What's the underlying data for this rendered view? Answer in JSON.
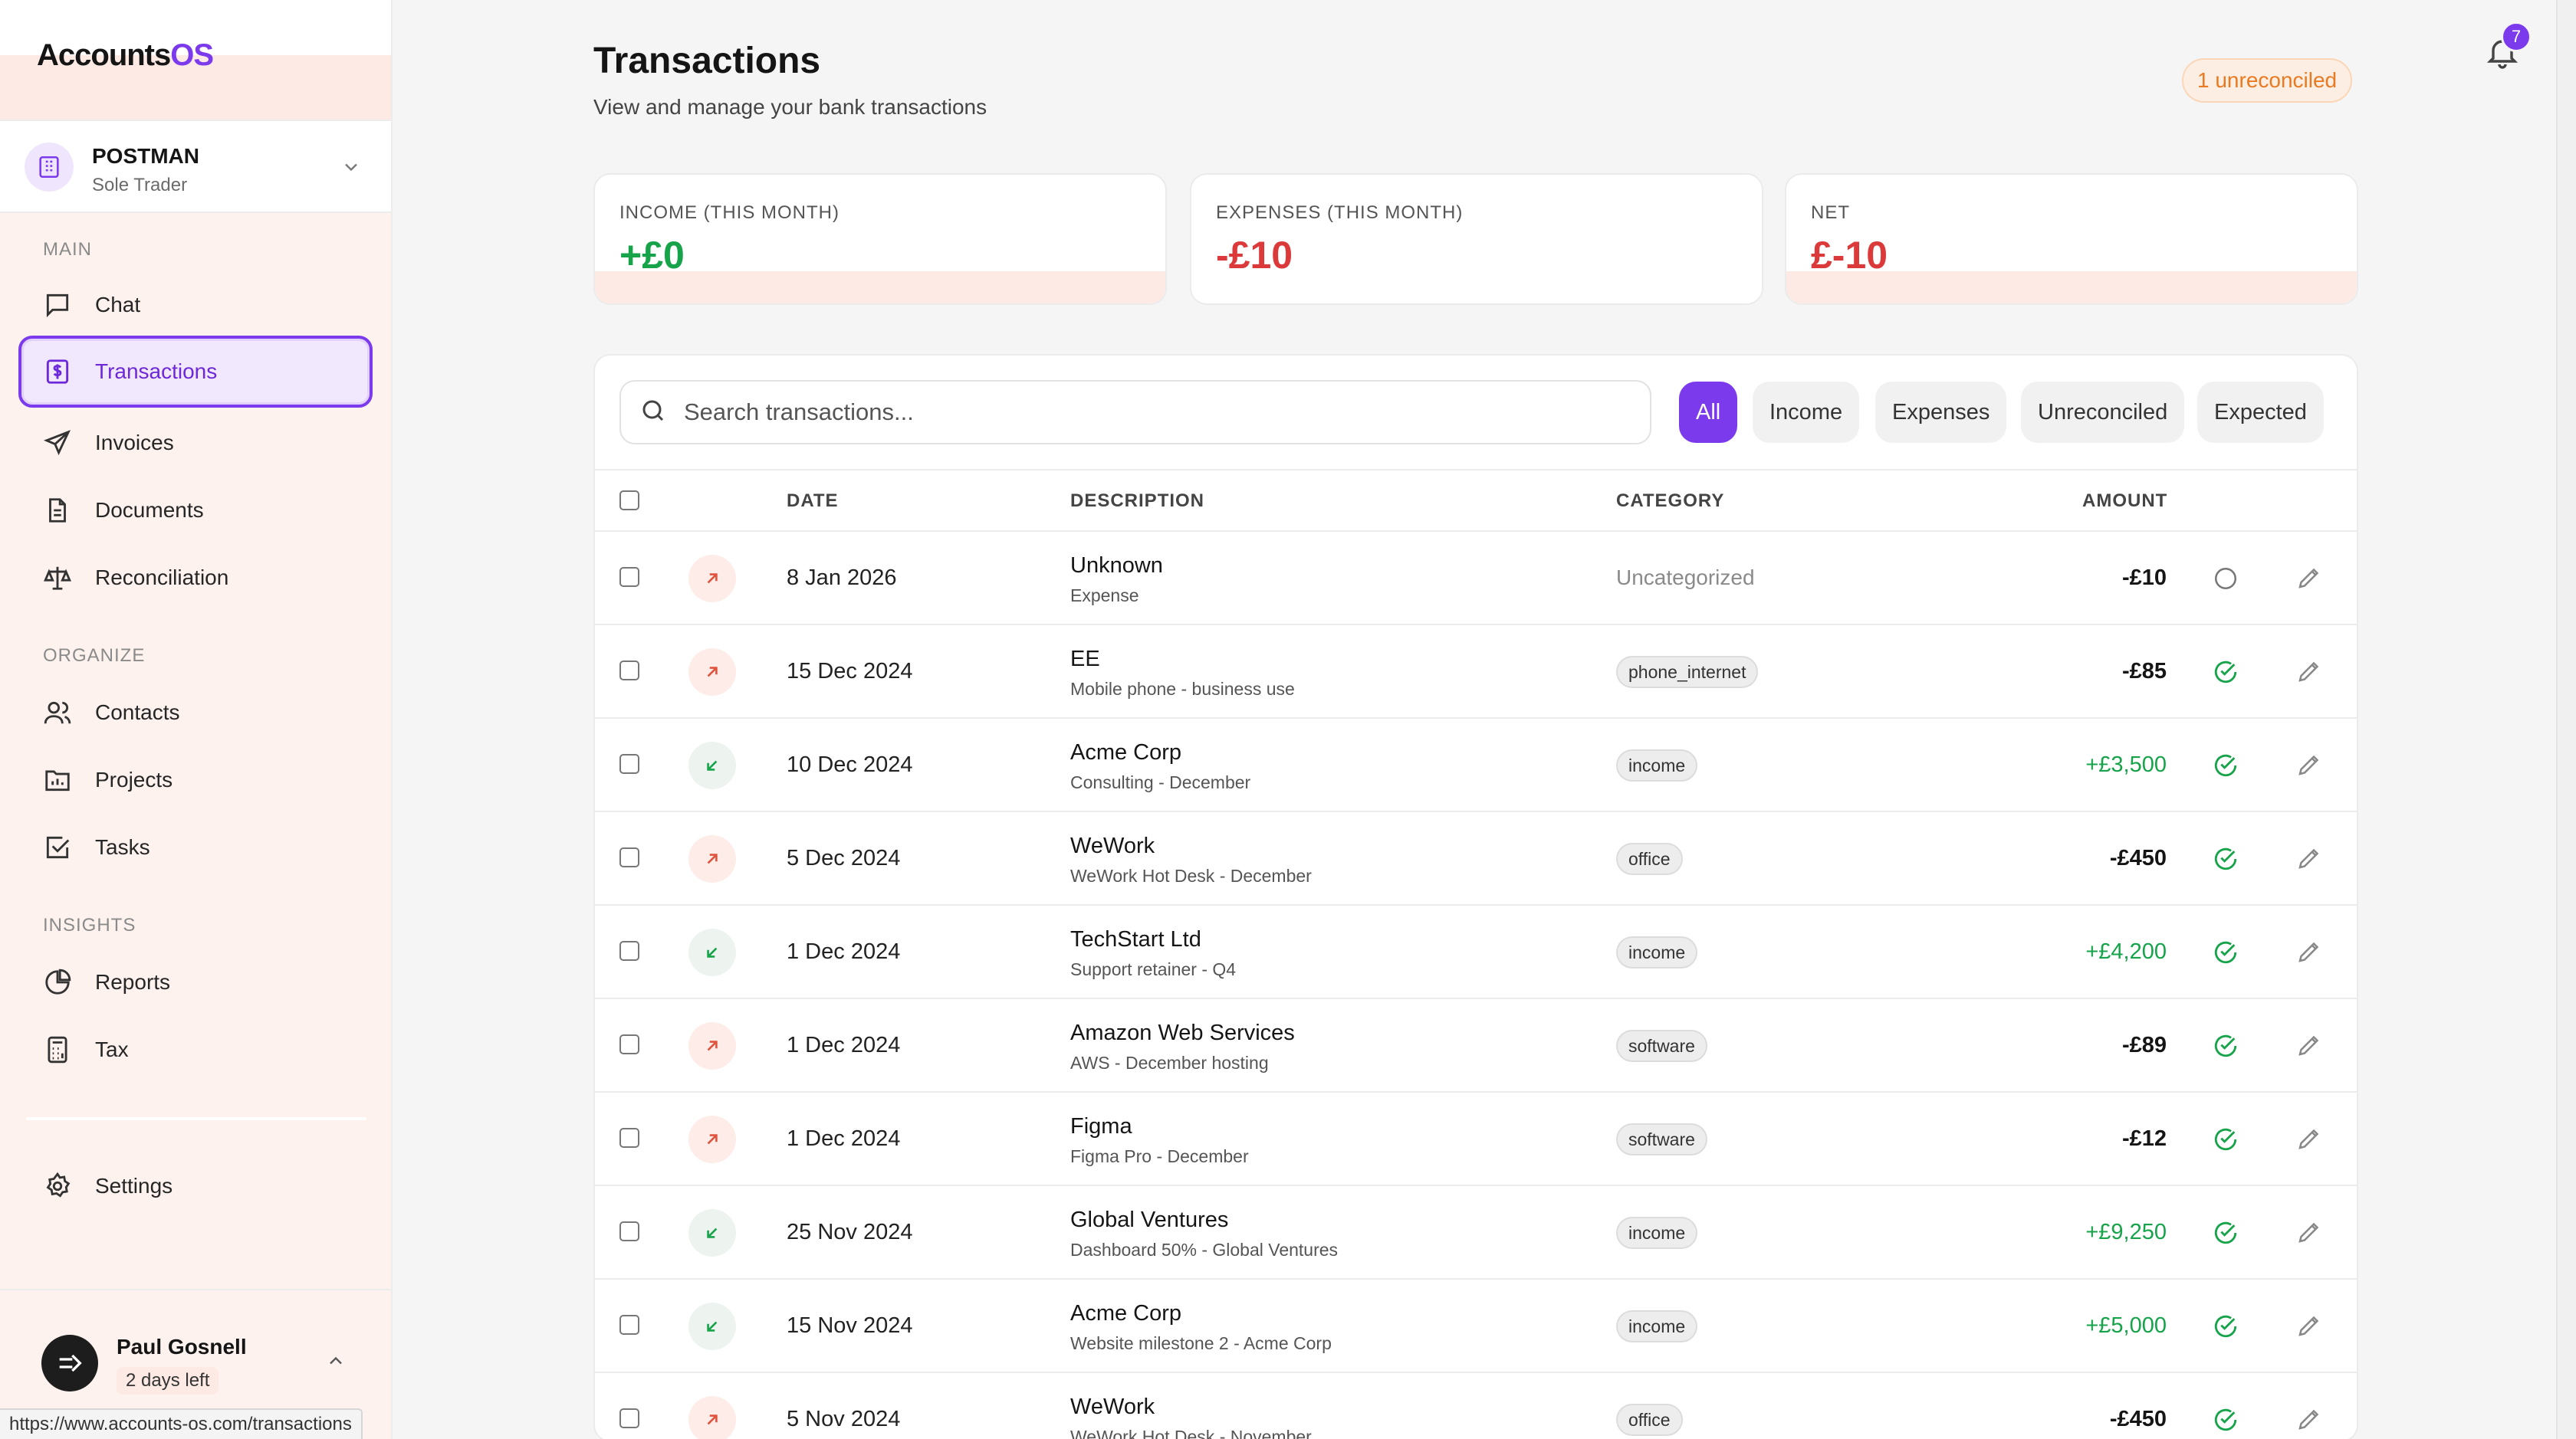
{
  "brand": {
    "part1": "Accounts",
    "part2": "OS"
  },
  "org": {
    "name": "POSTMAN",
    "type": "Sole Trader"
  },
  "nav": {
    "section_main": "MAIN",
    "section_organize": "ORGANIZE",
    "section_insights": "INSIGHTS",
    "chat": "Chat",
    "transactions": "Transactions",
    "invoices": "Invoices",
    "documents": "Documents",
    "reconciliation": "Reconciliation",
    "contacts": "Contacts",
    "projects": "Projects",
    "tasks": "Tasks",
    "reports": "Reports",
    "tax": "Tax",
    "settings": "Settings"
  },
  "user": {
    "name": "Paul Gosnell",
    "trial": "2 days left"
  },
  "statusbar_url": "https://www.accounts-os.com/transactions",
  "header": {
    "title": "Transactions",
    "subtitle": "View and manage your bank transactions",
    "unreconciled": "1 unreconciled",
    "notifications": "7"
  },
  "stats": {
    "income_label": "INCOME (THIS MONTH)",
    "income_value": "+£0",
    "expenses_label": "EXPENSES (THIS MONTH)",
    "expenses_value": "-£10",
    "net_label": "NET",
    "net_value": "£-10"
  },
  "search": {
    "placeholder": "Search transactions..."
  },
  "filters": [
    "All",
    "Income",
    "Expenses",
    "Unreconciled",
    "Expected"
  ],
  "columns": {
    "date": "DATE",
    "description": "DESCRIPTION",
    "category": "CATEGORY",
    "amount": "AMOUNT"
  },
  "rows": [
    {
      "date": "8 Jan 2026",
      "desc": "Unknown",
      "sub": "Expense",
      "category": "Uncategorized",
      "amount": "-£10"
    },
    {
      "date": "15 Dec 2024",
      "desc": "EE",
      "sub": "Mobile phone - business use",
      "category": "phone_internet",
      "amount": "-£85"
    },
    {
      "date": "10 Dec 2024",
      "desc": "Acme Corp",
      "sub": "Consulting - December",
      "category": "income",
      "amount": "+£3,500"
    },
    {
      "date": "5 Dec 2024",
      "desc": "WeWork",
      "sub": "WeWork Hot Desk - December",
      "category": "office",
      "amount": "-£450"
    },
    {
      "date": "1 Dec 2024",
      "desc": "TechStart Ltd",
      "sub": "Support retainer - Q4",
      "category": "income",
      "amount": "+£4,200"
    },
    {
      "date": "1 Dec 2024",
      "desc": "Amazon Web Services",
      "sub": "AWS - December hosting",
      "category": "software",
      "amount": "-£89"
    },
    {
      "date": "1 Dec 2024",
      "desc": "Figma",
      "sub": "Figma Pro - December",
      "category": "software",
      "amount": "-£12"
    },
    {
      "date": "25 Nov 2024",
      "desc": "Global Ventures",
      "sub": "Dashboard 50% - Global Ventures",
      "category": "income",
      "amount": "+£9,250"
    },
    {
      "date": "15 Nov 2024",
      "desc": "Acme Corp",
      "sub": "Website milestone 2 - Acme Corp",
      "category": "income",
      "amount": "+£5,000"
    },
    {
      "date": "5 Nov 2024",
      "desc": "WeWork",
      "sub": "WeWork Hot Desk - November",
      "category": "office",
      "amount": "-£450"
    }
  ],
  "colors": {
    "accent": "#7c3aed",
    "income": "#16a34a",
    "expense": "#dc3a3a",
    "sidebar_bg": "#fdf2ee"
  }
}
